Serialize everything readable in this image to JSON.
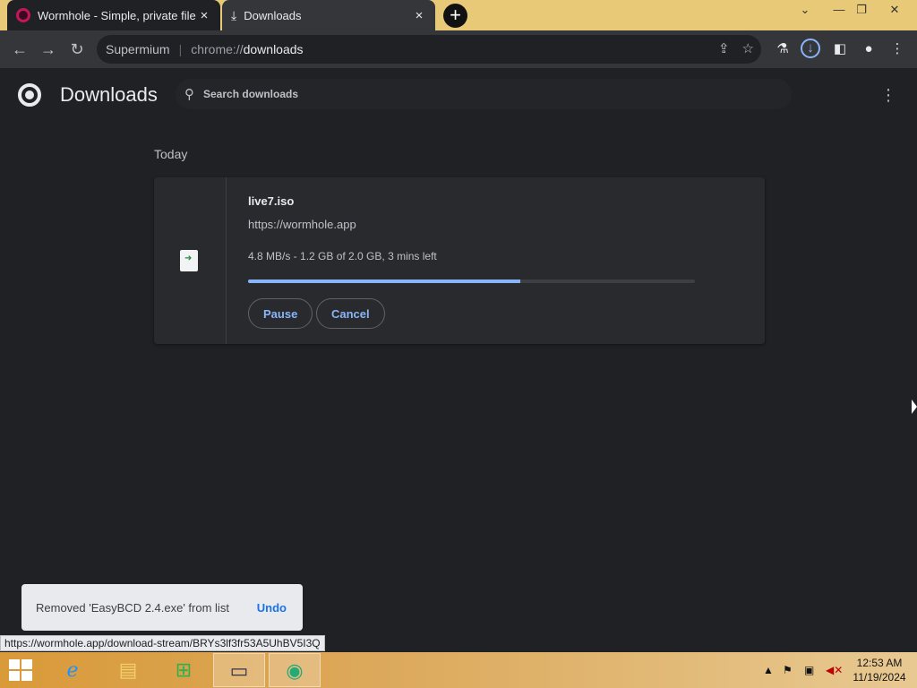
{
  "tabs": [
    {
      "title": "Wormhole - Simple, private file s",
      "close": "×"
    },
    {
      "title": "Downloads",
      "close": "×"
    }
  ],
  "new_tab_label": "+",
  "window_controls": {
    "minimize": "—",
    "restore": "❐",
    "close": "✕",
    "collapse": "⌄"
  },
  "toolbar": {
    "back": "←",
    "forward": "→",
    "reload": "↻"
  },
  "omnibox": {
    "site": "Supermium",
    "scheme": "chrome://",
    "path": "downloads"
  },
  "page": {
    "title": "Downloads",
    "search_placeholder": "Search downloads",
    "section": "Today"
  },
  "download": {
    "file_name": "live7.iso",
    "url": "https://wormhole.app",
    "status": "4.8 MB/s - 1.2 GB of 2.0 GB, 3 mins left",
    "progress_fraction": 0.61,
    "pause_label": "Pause",
    "cancel_label": "Cancel"
  },
  "toast": {
    "message": "Removed 'EasyBCD 2.4.exe' from list",
    "undo_label": "Undo"
  },
  "status_url": "https://wormhole.app/download-stream/BRYs3lf3fr53A5UhBV5I3Q",
  "taskbar": {
    "time": "12:53 AM",
    "date": "11/19/2024"
  },
  "colors": {
    "accent": "#8ab4f8",
    "background": "#202124",
    "taskbar": "#d99a39"
  }
}
